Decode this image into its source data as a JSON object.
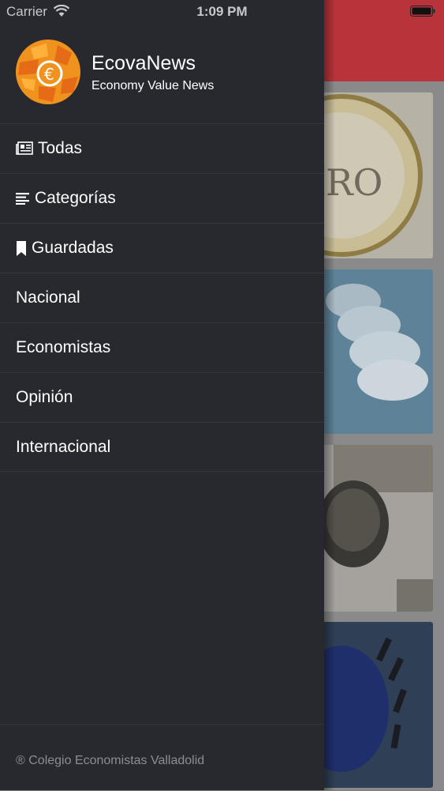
{
  "status_bar": {
    "carrier": "Carrier",
    "time": "1:09 PM",
    "icons": [
      "wifi-icon",
      "battery-icon"
    ]
  },
  "drawer": {
    "app_name": "EcovaNews",
    "app_subtitle": "Economy Value News",
    "logo_icon": "ecova-globe-logo",
    "menu": [
      {
        "label": "Todas",
        "icon": "newspaper-icon"
      },
      {
        "label": "Categorías",
        "icon": "list-icon"
      },
      {
        "label": "Guardadas",
        "icon": "bookmark-icon"
      },
      {
        "label": "Nacional",
        "icon": ""
      },
      {
        "label": "Economistas",
        "icon": ""
      },
      {
        "label": "Opinión",
        "icon": ""
      },
      {
        "label": "Internacional",
        "icon": ""
      }
    ],
    "footer": "® Colegio Economistas Valladolid"
  },
  "colors": {
    "drawer_bg": "#28292e",
    "header_red": "#b9343a",
    "divider": "#34363b",
    "logo_orange": "#f0921e"
  }
}
